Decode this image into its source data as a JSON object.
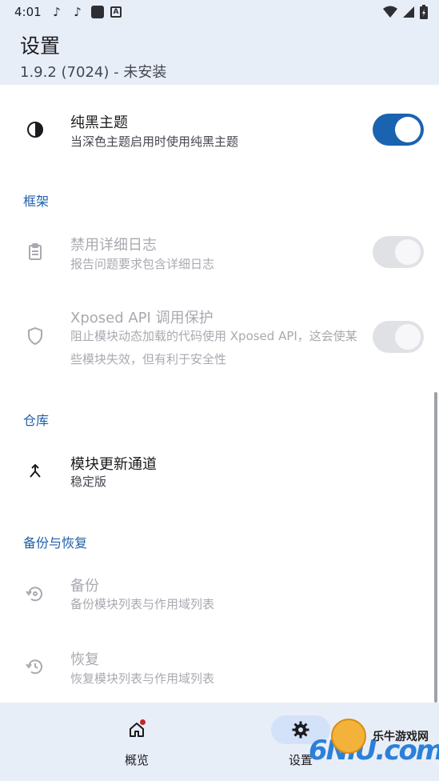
{
  "status_bar": {
    "time": "4:01",
    "left_icons": [
      "tiktok-icon",
      "tiktok-icon",
      "app-square-icon",
      "a-notification-icon"
    ],
    "right_icons": [
      "wifi-icon",
      "signal-icon",
      "battery-charging-icon"
    ]
  },
  "app_bar": {
    "title": "设置",
    "subtitle": "1.9.2 (7024) - 未安装"
  },
  "prefs": {
    "black_theme": {
      "title": "纯黑主题",
      "summary": "当深色主题启用时使用纯黑主题",
      "checked": true,
      "enabled": true
    },
    "verbose_log": {
      "title": "禁用详细日志",
      "summary": "报告问题要求包含详细日志",
      "checked": false,
      "enabled": false
    },
    "xposed_api": {
      "title": "Xposed API 调用保护",
      "summary": "阻止模块动态加载的代码使用 Xposed API，这会使某些模块失效，但有利于安全性",
      "checked": false,
      "enabled": false
    },
    "update_channel": {
      "title": "模块更新通道",
      "summary": "稳定版"
    },
    "backup": {
      "title": "备份",
      "summary": "备份模块列表与作用域列表",
      "enabled": false
    },
    "restore": {
      "title": "恢复",
      "summary": "恢复模块列表与作用域列表",
      "enabled": false
    }
  },
  "sections": {
    "framework": "框架",
    "repo": "仓库",
    "backup_restore": "备份与恢复"
  },
  "nav": {
    "overview": "概览",
    "settings": "设置",
    "active": "settings"
  },
  "watermark": {
    "site_name": "乐牛游戏网",
    "logo": "6NiU.com"
  },
  "colors": {
    "accent": "#1a63b0",
    "section_header": "#1f5fa8",
    "app_bar_bg": "#e8eef8",
    "disabled_text": "#a8aab0"
  }
}
